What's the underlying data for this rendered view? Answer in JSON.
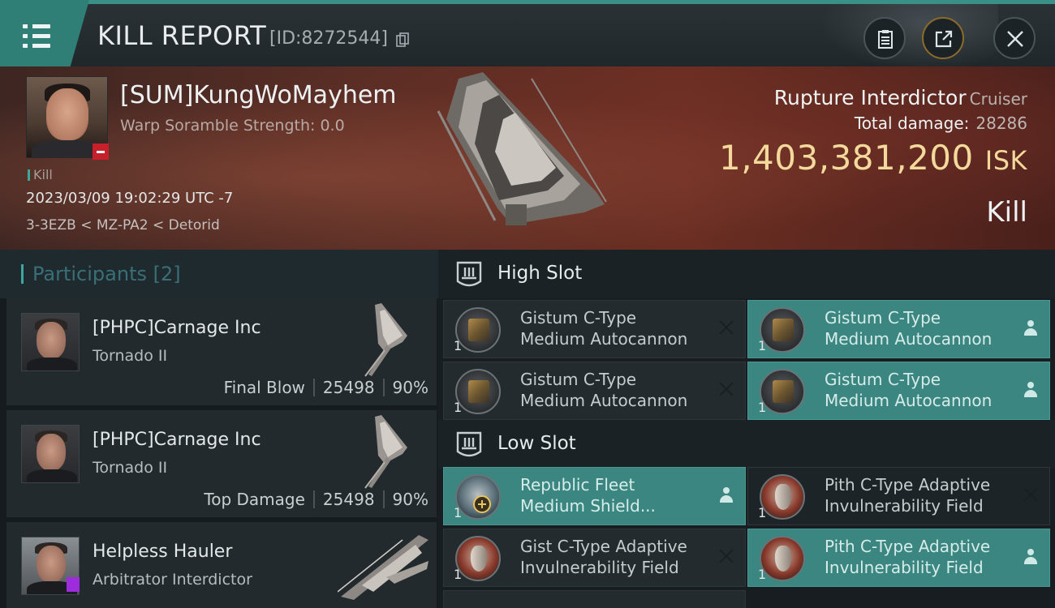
{
  "header": {
    "title": "KILL REPORT",
    "report_id": "[ID:8272544]"
  },
  "victim": {
    "pilot_name": "[SUM]KungWoMayhem",
    "scramble": "Warp Soramble Strength: 0.0",
    "kill_tag": "Kill",
    "datetime": "2023/03/09 19:02:29 UTC -7",
    "location": "3-3EZB < MZ-PA2 < Detorid",
    "ship_name": "Rupture Interdictor",
    "ship_class": "Cruiser",
    "total_damage_label": "Total damage:",
    "total_damage": "28286",
    "isk_value": "1,403,381,200",
    "isk_unit": "ISK",
    "result": "Kill"
  },
  "participants": {
    "title": "Participants",
    "count": "[2]",
    "items": [
      {
        "name": "[PHPC]Carnage Inc",
        "ship": "Tornado II",
        "role": "Final Blow",
        "damage": "25498",
        "percent": "90%"
      },
      {
        "name": "[PHPC]Carnage Inc",
        "ship": "Tornado II",
        "role": "Top Damage",
        "damage": "25498",
        "percent": "90%"
      },
      {
        "name": "Helpless Hauler",
        "ship": "Arbitrator Interdictor"
      }
    ]
  },
  "fitting": {
    "high_slot": {
      "title": "High Slot",
      "modules": [
        {
          "qty": "1",
          "line1": "Gistum C-Type",
          "line2": "Medium Autocannon",
          "status": "destroyed"
        },
        {
          "qty": "1",
          "line1": "Gistum C-Type",
          "line2": "Medium Autocannon",
          "status": "dropped"
        },
        {
          "qty": "1",
          "line1": "Gistum C-Type",
          "line2": "Medium Autocannon",
          "status": "destroyed"
        },
        {
          "qty": "1",
          "line1": "Gistum C-Type",
          "line2": "Medium Autocannon",
          "status": "dropped"
        }
      ]
    },
    "low_slot": {
      "title": "Low Slot",
      "modules": [
        {
          "qty": "1",
          "line1": "Republic Fleet",
          "line2": "Medium Shield...",
          "status": "dropped"
        },
        {
          "qty": "1",
          "line1": "Pith C-Type Adaptive",
          "line2": "Invulnerability Field",
          "status": "destroyed"
        },
        {
          "qty": "1",
          "line1": "Gist C-Type Adaptive",
          "line2": "Invulnerability Field",
          "status": "destroyed"
        },
        {
          "qty": "1",
          "line1": "Pith C-Type Adaptive",
          "line2": "Invulnerability Field",
          "status": "dropped"
        }
      ]
    }
  },
  "colors": {
    "accent": "#3a8f86",
    "isk_gold": "#f3d99c",
    "dropped_bg": "#3b8680",
    "destroyed_bg": "#232b2e"
  },
  "icons": [
    "menu-icon",
    "copy-icon",
    "clipboard-icon",
    "share-icon",
    "close-icon",
    "slot-icon",
    "destroyed-x-icon",
    "dropped-user-icon",
    "plus-icon"
  ]
}
